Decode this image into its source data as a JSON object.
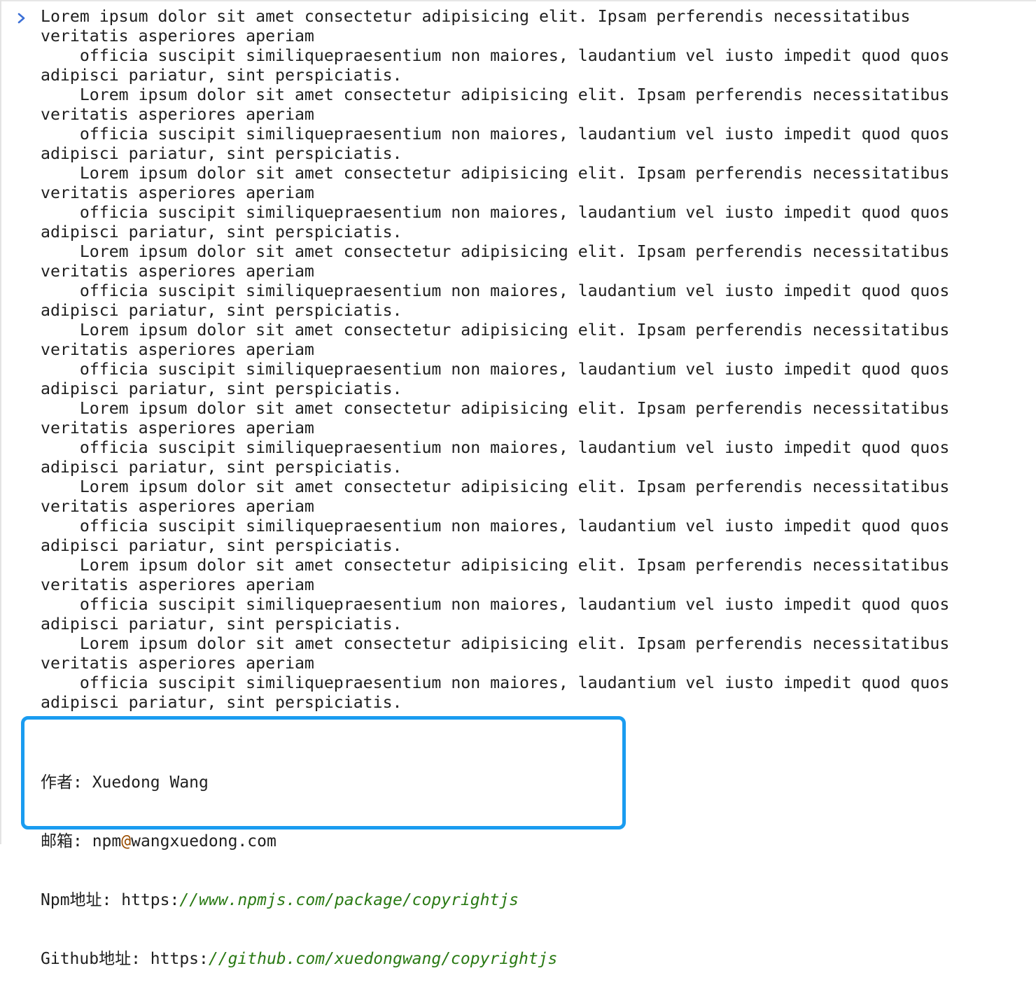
{
  "console": {
    "prompt_icon": "chevron-right-icon",
    "log_message": "Lorem ipsum dolor sit amet consectetur adipisicing elit. Ipsam perferendis necessitatibus\nveritatis asperiores aperiam\n    officia suscipit similiquepraesentium non maiores, laudantium vel iusto impedit quod quos\nadipisci pariatur, sint perspiciatis.\n    Lorem ipsum dolor sit amet consectetur adipisicing elit. Ipsam perferendis necessitatibus\nveritatis asperiores aperiam\n    officia suscipit similiquepraesentium non maiores, laudantium vel iusto impedit quod quos\nadipisci pariatur, sint perspiciatis.\n    Lorem ipsum dolor sit amet consectetur adipisicing elit. Ipsam perferendis necessitatibus\nveritatis asperiores aperiam\n    officia suscipit similiquepraesentium non maiores, laudantium vel iusto impedit quod quos\nadipisci pariatur, sint perspiciatis.\n    Lorem ipsum dolor sit amet consectetur adipisicing elit. Ipsam perferendis necessitatibus\nveritatis asperiores aperiam\n    officia suscipit similiquepraesentium non maiores, laudantium vel iusto impedit quod quos\nadipisci pariatur, sint perspiciatis.\n    Lorem ipsum dolor sit amet consectetur adipisicing elit. Ipsam perferendis necessitatibus\nveritatis asperiores aperiam\n    officia suscipit similiquepraesentium non maiores, laudantium vel iusto impedit quod quos\nadipisci pariatur, sint perspiciatis.\n    Lorem ipsum dolor sit amet consectetur adipisicing elit. Ipsam perferendis necessitatibus\nveritatis asperiores aperiam\n    officia suscipit similiquepraesentium non maiores, laudantium vel iusto impedit quod quos\nadipisci pariatur, sint perspiciatis.\n    Lorem ipsum dolor sit amet consectetur adipisicing elit. Ipsam perferendis necessitatibus\nveritatis asperiores aperiam\n    officia suscipit similiquepraesentium non maiores, laudantium vel iusto impedit quod quos\nadipisci pariatur, sint perspiciatis.\n    Lorem ipsum dolor sit amet consectetur adipisicing elit. Ipsam perferendis necessitatibus\nveritatis asperiores aperiam\n    officia suscipit similiquepraesentium non maiores, laudantium vel iusto impedit quod quos\nadipisci pariatur, sint perspiciatis.\n    Lorem ipsum dolor sit amet consectetur adipisicing elit. Ipsam perferendis necessitatibus\nveritatis asperiores aperiam\n    officia suscipit similiquepraesentium non maiores, laudantium vel iusto impedit quod quos\nadipisci pariatur, sint perspiciatis."
  },
  "copyright": {
    "author": {
      "label": "作者: ",
      "value": "Xuedong Wang"
    },
    "email": {
      "label": "邮箱: ",
      "user": "npm",
      "at": "@",
      "domain": "wangxuedong.com"
    },
    "npm": {
      "label": "Npm地址: ",
      "scheme": "https:",
      "rest": "//www.npmjs.com/package/copyrightjs"
    },
    "github": {
      "label": "Github地址: ",
      "scheme": "https:",
      "rest": "//github.com/xuedongwang/copyrightjs"
    }
  },
  "colors": {
    "box_border": "#1a9cf0",
    "prompt": "#3b6fd6",
    "url": "#2a7a14",
    "at_sign": "#9a4d00"
  }
}
